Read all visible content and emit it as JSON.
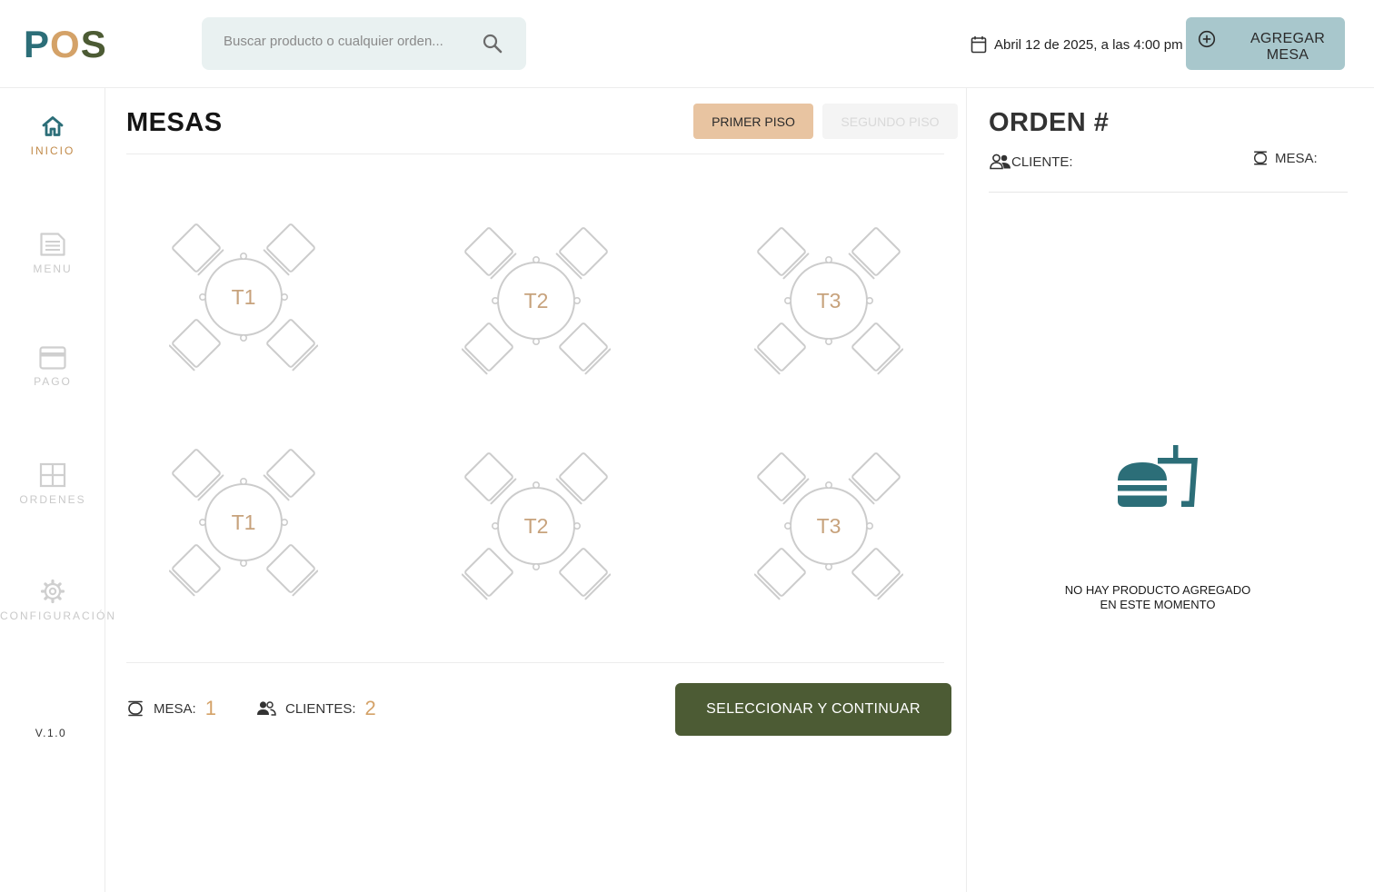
{
  "app": {
    "logo": [
      "P",
      "O",
      "S"
    ]
  },
  "header": {
    "search_placeholder": "Buscar producto o cualquier orden...",
    "date_text": "Abril 12 de 2025, a las 4:00 pm",
    "add_table_label": "AGREGAR MESA"
  },
  "sidebar": {
    "items": [
      {
        "label": "INICIO",
        "icon": "home-icon",
        "active": true
      },
      {
        "label": "MENU",
        "icon": "document-icon",
        "active": false
      },
      {
        "label": "PAGO",
        "icon": "credit-card-icon",
        "active": false
      },
      {
        "label": "ORDENES",
        "icon": "grid-icon",
        "active": false
      },
      {
        "label": "CONFIGURACIÓN",
        "icon": "gear-icon",
        "active": false
      }
    ],
    "version": "V.1.0"
  },
  "main": {
    "title": "MESAS",
    "floors": [
      "PRIMER PISO",
      "SEGUNDO PISO"
    ],
    "active_floor": "PRIMER PISO",
    "tables": [
      {
        "label": "T1"
      },
      {
        "label": "T2"
      },
      {
        "label": "T3"
      },
      {
        "label": "T1"
      },
      {
        "label": "T2"
      },
      {
        "label": "T3"
      }
    ],
    "footer": {
      "mesa_label": "MESA:",
      "mesa_value": "1",
      "clientes_label": "CLIENTES:",
      "clientes_value": "2",
      "select_button": "SELECCIONAR Y CONTINUAR"
    }
  },
  "order": {
    "title": "ORDEN #",
    "client_label": "CLIENTE:",
    "mesa_label": "MESA:",
    "empty_line1": "NO HAY PRODUCTO AGREGADO",
    "empty_line2": "EN ESTE MOMENTO"
  },
  "colors": {
    "teal": "#2c6e78",
    "orange": "#d4a268",
    "olive": "#4c5b34",
    "floor_active": "#e8c4a1",
    "add_button": "#a8c7cc"
  }
}
